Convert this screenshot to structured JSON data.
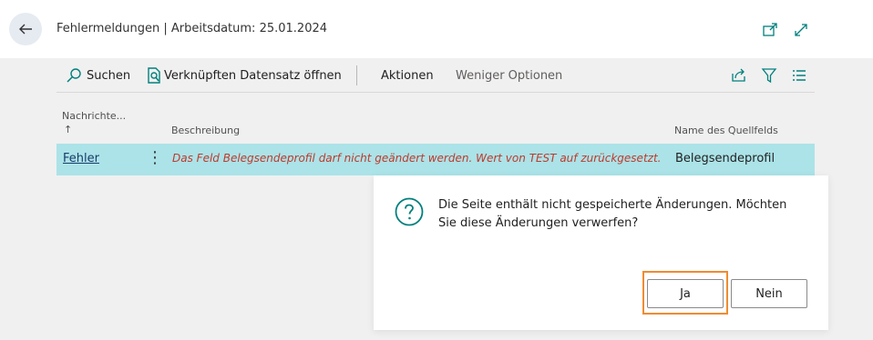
{
  "header": {
    "title": "Fehlermeldungen | Arbeitsdatum: 25.01.2024"
  },
  "toolbar": {
    "search_label": "Suchen",
    "open_record_label": "Verknüpften Datensatz öffnen",
    "actions_label": "Aktionen",
    "fewer_options_label": "Weniger Optionen"
  },
  "table": {
    "columns": {
      "messages": "Nachrichte...",
      "sort_arrow": "↑",
      "description": "Beschreibung",
      "source_field": "Name des Quellfelds"
    },
    "rows": [
      {
        "type": "Fehler",
        "description": "Das Feld Belegsendeprofil darf nicht geändert werden. Wert von TEST auf  zurückgesetzt.",
        "source_field": "Belegsendeprofil"
      }
    ]
  },
  "dialog": {
    "message": "Die Seite enthält nicht gespeicherte Änderungen. Möchten Sie diese Änderungen verwerfen?",
    "yes_label": "Ja",
    "no_label": "Nein"
  },
  "colors": {
    "row_highlight": "#abe3e8",
    "accent": "#00807d",
    "error_text": "#c0392b",
    "focus_outline": "#ef8c31"
  }
}
